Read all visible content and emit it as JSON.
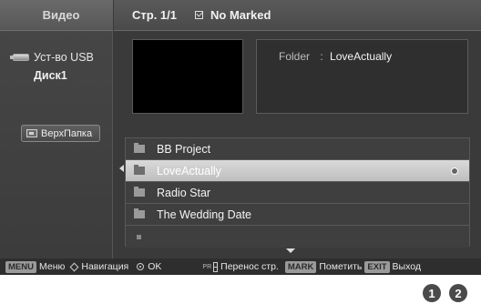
{
  "sidebar": {
    "title": "Видео",
    "device_label": "Уст-во USB",
    "disk_label": "Диск1",
    "up_folder_label": "ВерхПапка"
  },
  "header": {
    "page": "Стр. 1/1",
    "marked_text": "No Marked"
  },
  "info": {
    "folder_key": "Folder",
    "separator": ":",
    "folder_value": "LoveActually"
  },
  "file_list": {
    "items": [
      {
        "label": "BB Project",
        "type": "folder",
        "selected": false
      },
      {
        "label": "LoveActually",
        "type": "folder",
        "selected": true
      },
      {
        "label": "Radio Star",
        "type": "folder",
        "selected": false
      },
      {
        "label": "The Wedding Date",
        "type": "folder",
        "selected": false
      },
      {
        "label": "",
        "type": "empty",
        "selected": false
      }
    ]
  },
  "footer": {
    "menu_key": "MENU",
    "menu_text": "Меню",
    "nav_text": "Навигация",
    "ok_text": "OK",
    "pr_text": "PR",
    "page_move_text": "Перенос стр.",
    "mark_key": "MARK",
    "mark_text": "Пометить",
    "exit_key": "EXIT",
    "exit_text": "Выход"
  },
  "callouts": {
    "first": "1",
    "second": "2"
  }
}
